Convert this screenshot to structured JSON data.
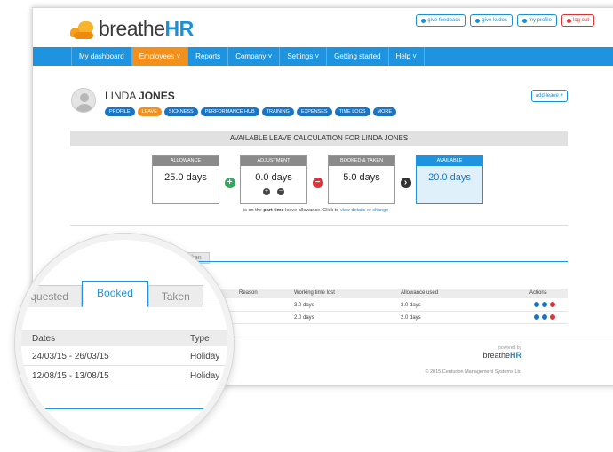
{
  "header": {
    "logo_text": "breathe",
    "logo_text_bold": "HR",
    "toplinks": [
      "give feedback",
      "give kudos",
      "my profile",
      "log out"
    ]
  },
  "nav": {
    "items": [
      "My dashboard",
      "Employees ˅",
      "Reports",
      "Company ˅",
      "Settings ˅",
      "Getting started",
      "Help ˅"
    ],
    "active_index": 1
  },
  "profile": {
    "first_name": "LINDA",
    "last_name": "JONES",
    "add_leave": "add leave +",
    "tabs": [
      "PROFILE",
      "LEAVE",
      "SICKNESS",
      "PERFORMANCE HUB",
      "TRAINING",
      "EXPENSES",
      "TIME LOGS",
      "MORE"
    ],
    "active_tab": "LEAVE"
  },
  "calc": {
    "title": "AVAILABLE LEAVE CALCULATION FOR LINDA JONES",
    "cards": [
      {
        "label": "ALLOWANCE",
        "value": "25.0 days"
      },
      {
        "label": "ADJUSTMENT",
        "value": "0.0 days"
      },
      {
        "label": "BOOKED & TAKEN",
        "value": "5.0 days"
      },
      {
        "label": "AVAILABLE",
        "value": "20.0 days"
      }
    ],
    "note_prefix": "is on the",
    "note_bold": "part time",
    "note_mid": "leave allowance. Click to",
    "note_link": "view details or change"
  },
  "table": {
    "small_tab": "Taken",
    "headers": [
      "Reason",
      "Working time lost",
      "Allowance used",
      "Actions"
    ],
    "rows": [
      {
        "working": "3.0 days",
        "allowance": "3.0 days"
      },
      {
        "working": "2.0 days",
        "allowance": "2.0 days"
      }
    ]
  },
  "footer": {
    "powered": "powered by",
    "brand": "breathe",
    "brand_bold": "HR",
    "copyright": "© 2015 Centurion Management Systems Ltd"
  },
  "magnifier": {
    "tabs": [
      "Requested",
      "Booked",
      "Taken"
    ],
    "active_tab": "Booked",
    "headers": [
      "Dates",
      "Type"
    ],
    "rows": [
      {
        "dates": "24/03/15 - 26/03/15",
        "type": "Holiday"
      },
      {
        "dates": "12/08/15 - 13/08/15",
        "type": "Holiday"
      }
    ]
  },
  "colors": {
    "nav_blue": "#1e94e0",
    "active_orange": "#f3901b",
    "brand_blue": "#1b8fd8"
  }
}
